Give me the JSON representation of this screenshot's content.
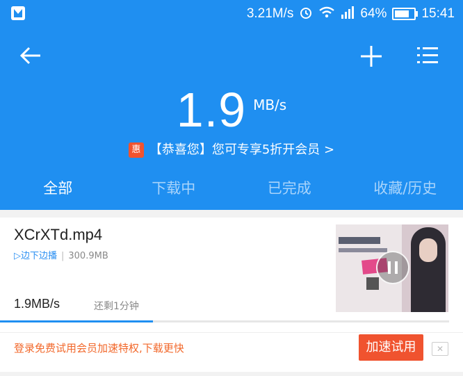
{
  "status_bar": {
    "network_speed": "3.21M/s",
    "battery_percent": "64%",
    "time": "15:41",
    "icons": [
      "app-notification-icon",
      "alarm-icon",
      "wifi-icon",
      "signal-icon",
      "battery-icon"
    ]
  },
  "header": {
    "back_icon": "arrow-left-icon",
    "add_icon": "plus-icon",
    "menu_icon": "list-menu-icon"
  },
  "speed": {
    "value": "1.9",
    "unit": "MB/s"
  },
  "promo": {
    "badge": "惠",
    "text": "【恭喜您】您可专享5折开会员 >"
  },
  "tabs": [
    {
      "label": "全部",
      "active": true
    },
    {
      "label": "下载中",
      "active": false
    },
    {
      "label": "已完成",
      "active": false
    },
    {
      "label": "收藏/历史",
      "active": false
    }
  ],
  "download": {
    "filename": "XCrXTd.mp4",
    "play_label": "▷边下边播",
    "size": "300.9MB",
    "speed": "1.9MB/s",
    "remaining": "还剩1分钟",
    "progress": 0.34
  },
  "offer": {
    "text": "登录免费试用会员加速特权,下载更快",
    "button": "加速试用",
    "close": "✕"
  },
  "colors": {
    "primary": "#1f8ff1",
    "accent": "#f0532f",
    "offer_text": "#f2682b"
  }
}
